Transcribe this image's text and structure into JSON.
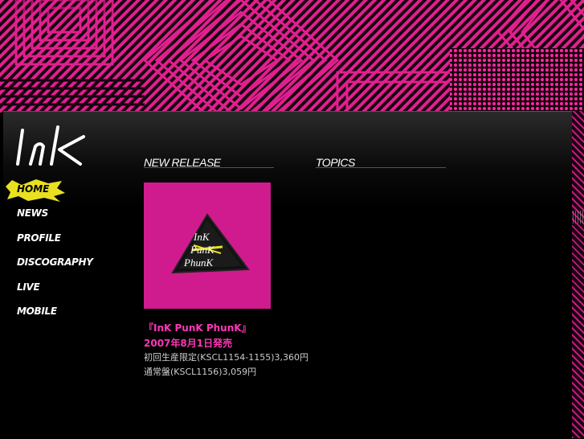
{
  "logo": {
    "text": "InK"
  },
  "nav": {
    "home": "HOME",
    "items": [
      "NEWS",
      "PROFILE",
      "DISCOGRAPHY",
      "LIVE",
      "MOBILE"
    ]
  },
  "sections": {
    "new_release": "NEW RELEASE",
    "topics": "TOPICS"
  },
  "release": {
    "jacket_lines": [
      "InK",
      "PunK",
      "PhunK"
    ],
    "title": "『InK PunK PhunK』",
    "date": "2007年8月1日発売",
    "line1": "初回生産限定(KSCL1154-1155)3,360円",
    "line2": "通常盤(KSCL1156)3,059円"
  },
  "colors": {
    "accent_pink": "#ff36b6",
    "banner_pink": "#e0208e",
    "home_yellow": "#e8e020"
  }
}
